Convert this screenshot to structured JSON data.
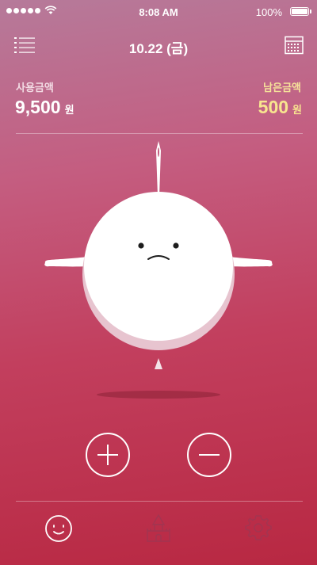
{
  "status_bar": {
    "time": "8:08 AM",
    "battery": "100%"
  },
  "header": {
    "date": "10.22 (금)",
    "menu_icon": "list-icon",
    "calendar_icon": "calendar-icon"
  },
  "summary": {
    "used_label": "사용금액",
    "used_amount": "9,500",
    "used_unit": "원",
    "remaining_label": "남은금액",
    "remaining_amount": "500",
    "remaining_unit": "원"
  },
  "character": {
    "mood": "worried",
    "description_icon": "balloon-character-icon",
    "needle_icon": "needle-icon"
  },
  "actions": {
    "add_icon": "plus-icon",
    "subtract_icon": "minus-icon"
  },
  "tab_bar": {
    "items": [
      {
        "icon": "smile-face-icon",
        "active": true
      },
      {
        "icon": "castle-icon",
        "active": false
      },
      {
        "icon": "gear-icon",
        "active": false
      }
    ]
  },
  "colors": {
    "remaining_accent": "#f8e58f",
    "background_top": "#b67a9a",
    "background_bottom": "#b82842"
  }
}
